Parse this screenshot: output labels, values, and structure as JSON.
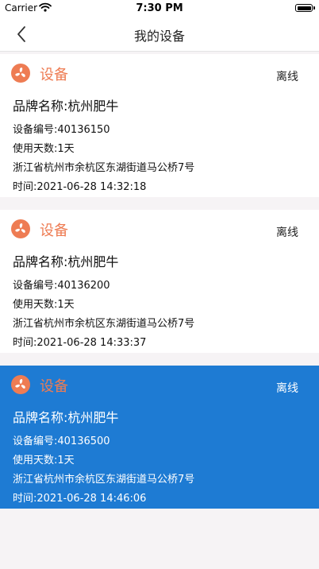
{
  "status_bar": {
    "carrier": "Carrier",
    "time": "7:30 PM"
  },
  "nav": {
    "title": "我的设备"
  },
  "devices": [
    {
      "name": "设备",
      "status": "离线",
      "brand": "品牌名称:杭州肥牛",
      "device_no": "设备编号:40136150",
      "days": "使用天数:1天",
      "address": "浙江省杭州市余杭区东湖街道马公桥7号",
      "time": "时间:2021-06-28 14:32:18",
      "selected": false
    },
    {
      "name": "设备",
      "status": "离线",
      "brand": "品牌名称:杭州肥牛",
      "device_no": "设备编号:40136200",
      "days": "使用天数:1天",
      "address": "浙江省杭州市余杭区东湖街道马公桥7号",
      "time": "时间:2021-06-28 14:33:37",
      "selected": false
    },
    {
      "name": "设备",
      "status": "离线",
      "brand": "品牌名称:杭州肥牛",
      "device_no": "设备编号:40136500",
      "days": "使用天数:1天",
      "address": "浙江省杭州市余杭区东湖街道马公桥7号",
      "time": "时间:2021-06-28 14:46:06",
      "selected": true
    }
  ],
  "icons": {
    "back": "chevron-left-icon",
    "device_logo": "fan-icon",
    "wifi": "wifi-icon",
    "battery": "battery-icon"
  },
  "colors": {
    "accent": "#ee7c53",
    "selected_card": "#1e7bd3",
    "background": "#f6f3f5"
  }
}
